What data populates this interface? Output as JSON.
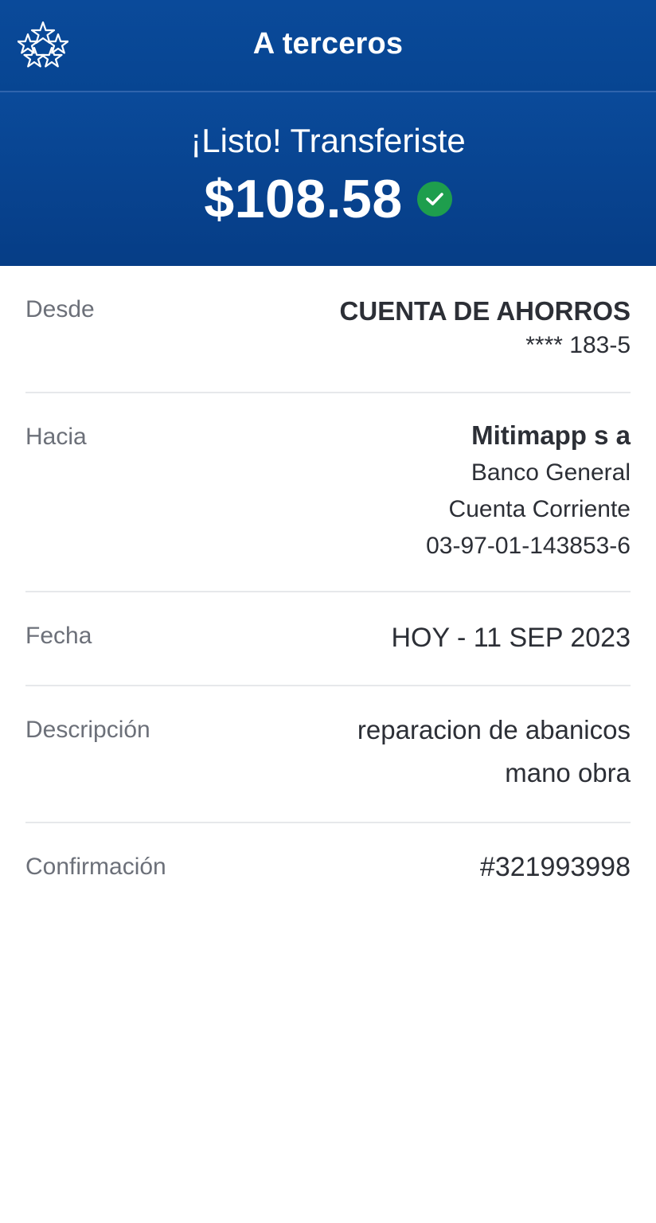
{
  "header": {
    "title": "A terceros",
    "logo_icon": "star-cluster-icon"
  },
  "hero": {
    "message": "¡Listo! Transferiste",
    "amount": "$108.58",
    "status_icon": "check-circle-icon",
    "status_color": "#1e9e4d",
    "background_color": "#0a4a9a"
  },
  "details": {
    "desde": {
      "label": "Desde",
      "account_type": "CUENTA DE AHORROS",
      "account_number": "**** 183-5"
    },
    "hacia": {
      "label": "Hacia",
      "name": "Mitimapp s a",
      "bank": "Banco General",
      "account_type": "Cuenta Corriente",
      "account_number": "03-97-01-143853-6"
    },
    "fecha": {
      "label": "Fecha",
      "value": "HOY - 11 SEP 2023"
    },
    "descripcion": {
      "label": "Descripción",
      "line1": "reparacion de abanicos",
      "line2": "mano obra"
    },
    "confirmacion": {
      "label": "Confirmación",
      "value": "#321993998"
    }
  }
}
